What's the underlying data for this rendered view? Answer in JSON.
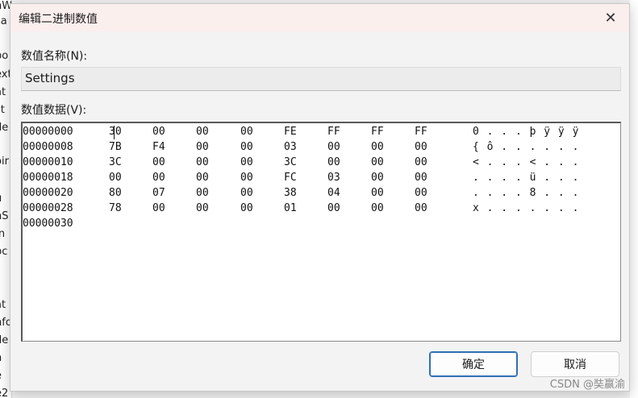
{
  "background": {
    "left_fragments": [
      "nWizard",
      "sa",
      "po",
      "ext",
      "at",
      "st",
      "de",
      "oir",
      "u",
      "nS",
      "In",
      "pc",
      "at",
      "nfo",
      "de",
      "n",
      "e",
      "e2"
    ],
    "top_fragment": "nWizard"
  },
  "dialog": {
    "title": "编辑二进制数值",
    "close_glyph": "✕",
    "name_label": "数值名称(N):",
    "name_value": "Settings",
    "data_label": "数值数据(V):",
    "ok_label": "确定",
    "cancel_label": "取消"
  },
  "hex_rows": [
    {
      "offset": "00000000",
      "bytes": [
        "30",
        "00",
        "00",
        "00",
        "FE",
        "FF",
        "FF",
        "FF"
      ],
      "ascii": "0 . . . þ ÿ ÿ ÿ"
    },
    {
      "offset": "00000008",
      "bytes": [
        "7B",
        "F4",
        "00",
        "00",
        "03",
        "00",
        "00",
        "00"
      ],
      "ascii": "{ ô . . . . . ."
    },
    {
      "offset": "00000010",
      "bytes": [
        "3C",
        "00",
        "00",
        "00",
        "3C",
        "00",
        "00",
        "00"
      ],
      "ascii": "< . . . < . . ."
    },
    {
      "offset": "00000018",
      "bytes": [
        "00",
        "00",
        "00",
        "00",
        "FC",
        "03",
        "00",
        "00"
      ],
      "ascii": ". . . . ü . . ."
    },
    {
      "offset": "00000020",
      "bytes": [
        "80",
        "07",
        "00",
        "00",
        "38",
        "04",
        "00",
        "00"
      ],
      "ascii": ". . . . 8 . . ."
    },
    {
      "offset": "00000028",
      "bytes": [
        "78",
        "00",
        "00",
        "00",
        "01",
        "00",
        "00",
        "00"
      ],
      "ascii": "x . . . . . . ."
    },
    {
      "offset": "00000030",
      "bytes": [],
      "ascii": ""
    }
  ],
  "watermark": "CSDN @奘嬴渝"
}
